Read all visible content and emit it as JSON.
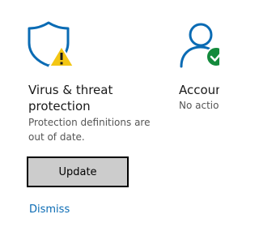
{
  "virus_tile": {
    "icon": "shield-warning-icon",
    "title_line1": "Virus & threat",
    "title_line2": "protection",
    "desc_line1": "Protection definitions are",
    "desc_line2": "out of date.",
    "update_label": "Update",
    "dismiss_label": "Dismiss"
  },
  "account_tile": {
    "icon": "account-check-icon",
    "title": "Accoun",
    "desc": "No actio"
  },
  "colors": {
    "accent_blue": "#0a6bb4",
    "warning_yellow": "#f3c614",
    "success_green": "#138a3c",
    "button_bg": "#cccccc"
  }
}
